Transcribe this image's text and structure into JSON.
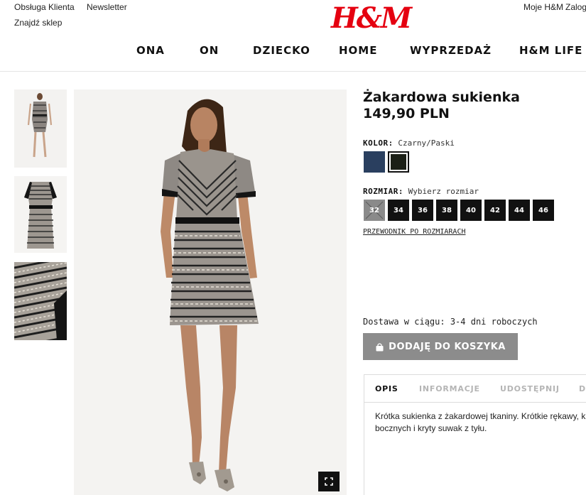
{
  "header": {
    "top_left_links": [
      "Obsługa Klienta",
      "Newsletter",
      "Znajdź sklep"
    ],
    "logo_text": "H&M",
    "top_right_links": [
      "Moje H&M",
      "Zalog"
    ],
    "nav": [
      "ONA",
      "ON",
      "DZIECKO",
      "HOME",
      "WYPRZEDAŻ",
      "H&M LIFE"
    ]
  },
  "product": {
    "title": "Żakardowa sukienka",
    "price": "149,90 PLN",
    "color_label": "KOLOR:",
    "color_value": "Czarny/Paski",
    "colors": [
      {
        "name": "navy",
        "hex": "#2a3f5f"
      },
      {
        "name": "black-stripes",
        "hex": "#1b1f16",
        "selected": true
      }
    ],
    "size_label": "ROZMIAR:",
    "size_prompt": "Wybierz rozmiar",
    "sizes": [
      {
        "label": "32",
        "available": false
      },
      {
        "label": "34",
        "available": true
      },
      {
        "label": "36",
        "available": true
      },
      {
        "label": "38",
        "available": true
      },
      {
        "label": "40",
        "available": true
      },
      {
        "label": "42",
        "available": true
      },
      {
        "label": "44",
        "available": true
      },
      {
        "label": "46",
        "available": true
      }
    ],
    "size_guide": "PRZEWODNIK PO ROZMIARACH",
    "delivery": "Dostawa w ciągu: 3-4 dni roboczych",
    "add_to_cart": "DODAJĘ DO KOSZYKA"
  },
  "tabs": {
    "items": [
      "OPIS",
      "INFORMACJE",
      "UDOSTĘPNIJ",
      "DO"
    ],
    "active": "OPIS",
    "description_line1": "Krótka sukienka z żakardowej tkaniny. Krótkie rękawy, kie",
    "description_line2": "bocznych i kryty suwak z tyłu."
  },
  "colors": {
    "brand_red": "#e50010",
    "button_gray": "#8c8c8c"
  }
}
